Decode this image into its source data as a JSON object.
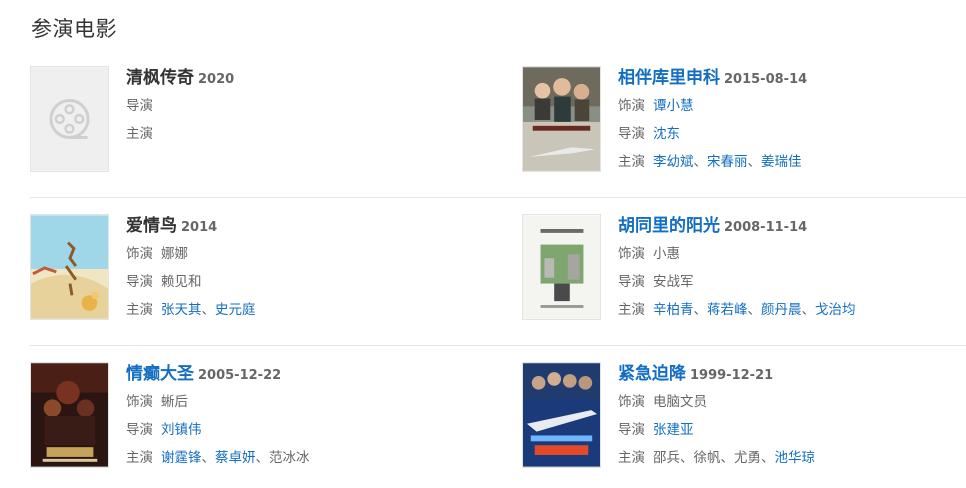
{
  "section_title": "参演电影",
  "labels": {
    "role": "饰演",
    "director": "导演",
    "cast": "主演",
    "separator": "、"
  },
  "movies": [
    {
      "title": "清枫传奇",
      "date": "2020",
      "title_linked": false,
      "poster_icon": "film-reel-placeholder-icon",
      "role": null,
      "director": "",
      "cast": []
    },
    {
      "title": "相伴库里申科",
      "date": "2015-08-14",
      "title_linked": true,
      "poster_icon": "poster-image",
      "role": {
        "text": "谭小慧",
        "linked": true
      },
      "director": {
        "text": "沈东",
        "linked": true
      },
      "cast": [
        {
          "text": "李幼斌",
          "linked": true
        },
        {
          "text": "宋春丽",
          "linked": true
        },
        {
          "text": "姜瑞佳",
          "linked": true
        }
      ]
    },
    {
      "title": "爱情鸟",
      "date": "2014",
      "title_linked": false,
      "poster_icon": "poster-image",
      "role": {
        "text": "娜娜",
        "linked": false
      },
      "director": {
        "text": "赖见和",
        "linked": false
      },
      "cast": [
        {
          "text": "张天其",
          "linked": true
        },
        {
          "text": "史元庭",
          "linked": true
        }
      ]
    },
    {
      "title": "胡同里的阳光",
      "date": "2008-11-14",
      "title_linked": true,
      "poster_icon": "poster-image",
      "role": {
        "text": "小惠",
        "linked": false
      },
      "director": {
        "text": "安战军",
        "linked": false
      },
      "cast": [
        {
          "text": "辛柏青",
          "linked": true
        },
        {
          "text": "蒋若峰",
          "linked": true
        },
        {
          "text": "颜丹晨",
          "linked": true
        },
        {
          "text": "戈治均",
          "linked": true
        }
      ]
    },
    {
      "title": "情癫大圣",
      "date": "2005-12-22",
      "title_linked": true,
      "poster_icon": "poster-image",
      "role": {
        "text": "蜥后",
        "linked": false
      },
      "director": {
        "text": "刘镇伟",
        "linked": true
      },
      "cast": [
        {
          "text": "谢霆锋",
          "linked": true
        },
        {
          "text": "蔡卓妍",
          "linked": true
        },
        {
          "text": "范冰冰",
          "linked": false
        }
      ]
    },
    {
      "title": "紧急迫降",
      "date": "1999-12-21",
      "title_linked": true,
      "poster_icon": "poster-image",
      "role": {
        "text": "电脑文员",
        "linked": false
      },
      "director": {
        "text": "张建亚",
        "linked": true
      },
      "cast": [
        {
          "text": "邵兵",
          "linked": false
        },
        {
          "text": "徐帆",
          "linked": false
        },
        {
          "text": "尤勇",
          "linked": false
        },
        {
          "text": "池华琼",
          "linked": true
        }
      ]
    }
  ]
}
